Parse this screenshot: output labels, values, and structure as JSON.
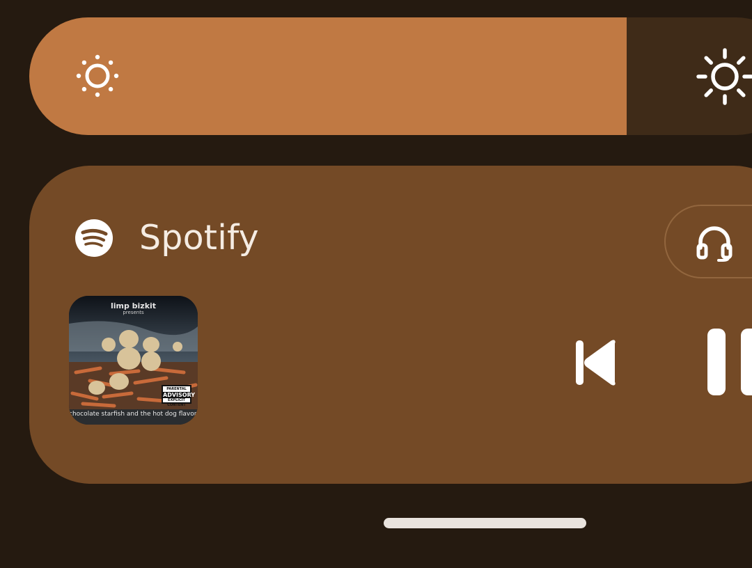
{
  "colors": {
    "background": "#251a10",
    "slider_track": "#3f2b18",
    "slider_fill": "#c07943",
    "card": "#744a26",
    "icon": "#f5ece3"
  },
  "brightness": {
    "level": 0.78,
    "low_icon": "brightness-low-icon",
    "high_icon": "brightness-high-icon"
  },
  "media": {
    "app_icon": "spotify-icon",
    "app_name": "Spotify",
    "output_icon": "headphones-icon",
    "album_art": {
      "band": "limp bizkit",
      "subtitle": "presents",
      "caption": "chocolate starfish and the hot dog flavored water",
      "badge_top": "PARENTAL",
      "badge_main": "ADVISORY",
      "badge_bottom": "EXPLICIT CONTENT"
    },
    "controls": [
      "previous-icon",
      "pause-icon"
    ]
  }
}
